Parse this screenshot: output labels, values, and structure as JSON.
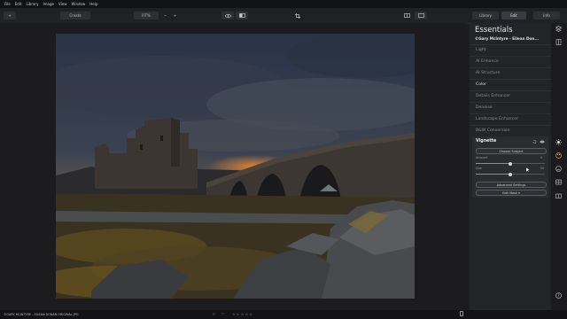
{
  "menu": [
    "File",
    "Edit",
    "Library",
    "Image",
    "View",
    "Window",
    "Help"
  ],
  "toolbar": {
    "create_label": "Create",
    "zoom_label": "FIT%",
    "zoom_out": "−",
    "zoom_in": "+",
    "library_tab": "Library",
    "edit_tab": "Edit",
    "info_tab": "Info"
  },
  "panel": {
    "title": "Essentials",
    "preset": "©Gary McIntyre - Eilean Don...",
    "sections": [
      "Light",
      "AI Enhance",
      "AI Structure",
      "Color",
      "Details Enhancer",
      "Denoise",
      "Landscape Enhancer",
      "B&W Conversion"
    ],
    "vignette": {
      "title": "Vignette",
      "choose_subject": "Choose Subject",
      "amount_label": "Amount",
      "amount_value": "0",
      "amount": 0.5,
      "size_label": "Size",
      "size_value": "50",
      "size": 0.5,
      "advanced": "Advanced Settings",
      "edit_mask": "Edit Mask ▾"
    }
  },
  "status": {
    "filename": "©GARY MCINTYRE - EILEAN DONAN ORIGINAL.JPG",
    "stars": "☆ ☆ ☆ ☆ ☆"
  },
  "colors": {
    "accent": "#3a3b40",
    "panel": "#232427",
    "background": "#1c1c1e"
  },
  "icons": [
    "back-icon",
    "compare-icon",
    "eye-icon",
    "split-view-icon",
    "crop-icon",
    "grid-view-icon",
    "single-view-icon",
    "sun-icon",
    "palette-icon",
    "face-icon",
    "layers-icon",
    "gift-icon",
    "help-icon"
  ]
}
